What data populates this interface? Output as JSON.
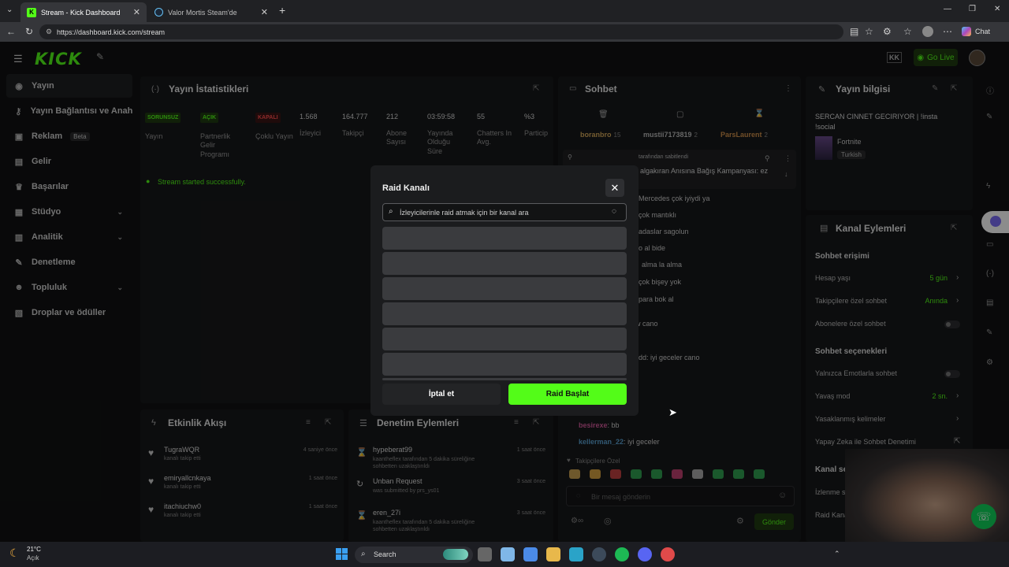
{
  "browser": {
    "tabs": [
      {
        "title": "Stream - Kick Dashboard",
        "active": true
      },
      {
        "title": "Valor Mortis Steam'de",
        "active": false
      }
    ],
    "url": "https://dashboard.kick.com/stream",
    "chat_label": "Chat"
  },
  "app": {
    "logo": "KICK",
    "go_live": "Go Live",
    "accent": "#53fc18"
  },
  "sidebar": {
    "items": [
      {
        "label": "Yayın",
        "icon": "broadcast-icon",
        "active": true
      },
      {
        "label": "Yayın Bağlantısı ve Anahtarı",
        "icon": "key-icon"
      },
      {
        "label": "Reklam",
        "icon": "ad-icon",
        "badge": "Beta"
      },
      {
        "label": "Gelir",
        "icon": "money-icon"
      },
      {
        "label": "Başarılar",
        "icon": "trophy-icon"
      },
      {
        "label": "Stüdyo",
        "icon": "studio-icon",
        "chevron": true
      },
      {
        "label": "Analitik",
        "icon": "chart-icon",
        "chevron": true
      },
      {
        "label": "Denetleme",
        "icon": "wrench-icon"
      },
      {
        "label": "Topluluk",
        "icon": "community-icon",
        "chevron": true
      },
      {
        "label": "Droplar ve ödüller",
        "icon": "gift-icon"
      }
    ]
  },
  "stats": {
    "title": "Yayın İstatistikleri",
    "badges": [
      {
        "badge": "SORUNSUZ",
        "label": "Yayın",
        "color": "#53fc18"
      },
      {
        "badge": "AÇIK",
        "label": "Partnerlik Gelir Programı",
        "color": "#53fc18"
      },
      {
        "badge": "KAPALI",
        "label": "Çoklu Yayın",
        "color": "#ff4d4d"
      }
    ],
    "items": [
      {
        "value": "1.568",
        "label": "İzleyici"
      },
      {
        "value": "164.777",
        "label": "Takipçi"
      },
      {
        "value": "212",
        "label": "Abone Sayısı"
      },
      {
        "value": "03:59:58",
        "label": "Yayında Olduğu Süre"
      },
      {
        "value": "55",
        "label": "Chatters In Avg."
      },
      {
        "value": "%3",
        "label": "Particip"
      }
    ],
    "success": "Stream started successfully."
  },
  "activity": {
    "title": "Etkinlik Akışı",
    "items": [
      {
        "name": "TugraWQR",
        "sub": "kanalı takip etti",
        "time": "4 saniye önce"
      },
      {
        "name": "emiryallcnkaya",
        "sub": "kanalı takip etti",
        "time": "1 saat önce"
      },
      {
        "name": "itachiuchw0",
        "sub": "kanalı takip etti",
        "time": "1 saat önce"
      }
    ]
  },
  "moderation": {
    "title": "Denetim Eylemleri",
    "items": [
      {
        "name": "hypeberat99",
        "sub": "kaantheflex tarafından 5 dakika süreliğine sohbetten uzaklaştırıldı",
        "time": "1 saat önce"
      },
      {
        "name": "Unban Request",
        "sub": "was submitted by prs_ys01",
        "time": "3 saat önce"
      },
      {
        "name": "eren_27i",
        "sub": "kaantheflex tarafından 5 dakika süreliğine sohbetten uzaklaştırıldı",
        "time": "3 saat önce"
      }
    ]
  },
  "chat": {
    "title": "Sohbet",
    "top_users": [
      {
        "name": "boranbro",
        "count": "15"
      },
      {
        "name": "mustii7173819",
        "count": "2"
      },
      {
        "name": "ParsLaurent",
        "count": "2"
      }
    ],
    "pinned_by": "tarafından sabitlendi",
    "pinned_text": "algakıran Anısına Bağış Kampanyası: ez",
    "messages": [
      {
        "user": "",
        "text": "Mercedes çok iyiydi ya"
      },
      {
        "user": "",
        "text": "çok mantıklı"
      },
      {
        "user": "",
        "text": "adaslar sagolun"
      },
      {
        "user": "",
        "text": "o al bide"
      },
      {
        "user": "",
        "text": "alma la alma"
      },
      {
        "user": "",
        "text": "çok bişey yok"
      },
      {
        "user": "",
        "text": "para bok al"
      },
      {
        "user": "",
        "text": "w cano"
      },
      {
        "user": "",
        "text": "dd: iyi geceler cano"
      },
      {
        "user": "besirexe",
        "text": "bb"
      },
      {
        "user": "kellerman_22",
        "text": "iyi geceler"
      }
    ],
    "followers_only": "Takipçilere Özel",
    "input_placeholder": "Bir mesaj gönderin",
    "send": "Gönder"
  },
  "stream_info": {
    "title": "Yayın bilgisi",
    "stream_title": "SERCAN CINNET GECIRIYOR | !insta !social",
    "category": "Fortnite",
    "language": "Turkish"
  },
  "channel_actions": {
    "title": "Kanal Eylemleri",
    "chat_access": "Sohbet erişimi",
    "rows": [
      {
        "label": "Hesap yaşı",
        "value": "5 gün"
      },
      {
        "label": "Takipçilere özel sohbet",
        "value": "Anında"
      },
      {
        "label": "Abonelere özel sohbet",
        "value": ""
      }
    ],
    "chat_options": "Sohbet seçenekleri",
    "rows2": [
      {
        "label": "Yalnızca Emotlarla sohbet",
        "value": ""
      },
      {
        "label": "Yavaş mod",
        "value": "2 sn."
      },
      {
        "label": "Yasaklanmış kelimeler",
        "value": ""
      },
      {
        "label": "Yapay Zeka ile Sohbet Denetimi",
        "value": ""
      }
    ],
    "channel_options": "Kanal seçenekleri",
    "rows3": [
      {
        "label": "İzlenme sayısını gös"
      },
      {
        "label": "Raid Kanalı"
      }
    ]
  },
  "modal": {
    "title": "Raid Kanalı",
    "search_placeholder": "İzleyicilerinle raid atmak için bir kanal ara",
    "cancel": "İptal et",
    "start": "Raid Başlat"
  },
  "taskbar": {
    "weather_temp": "21°C",
    "weather_text": "Açık",
    "search": "Search"
  }
}
